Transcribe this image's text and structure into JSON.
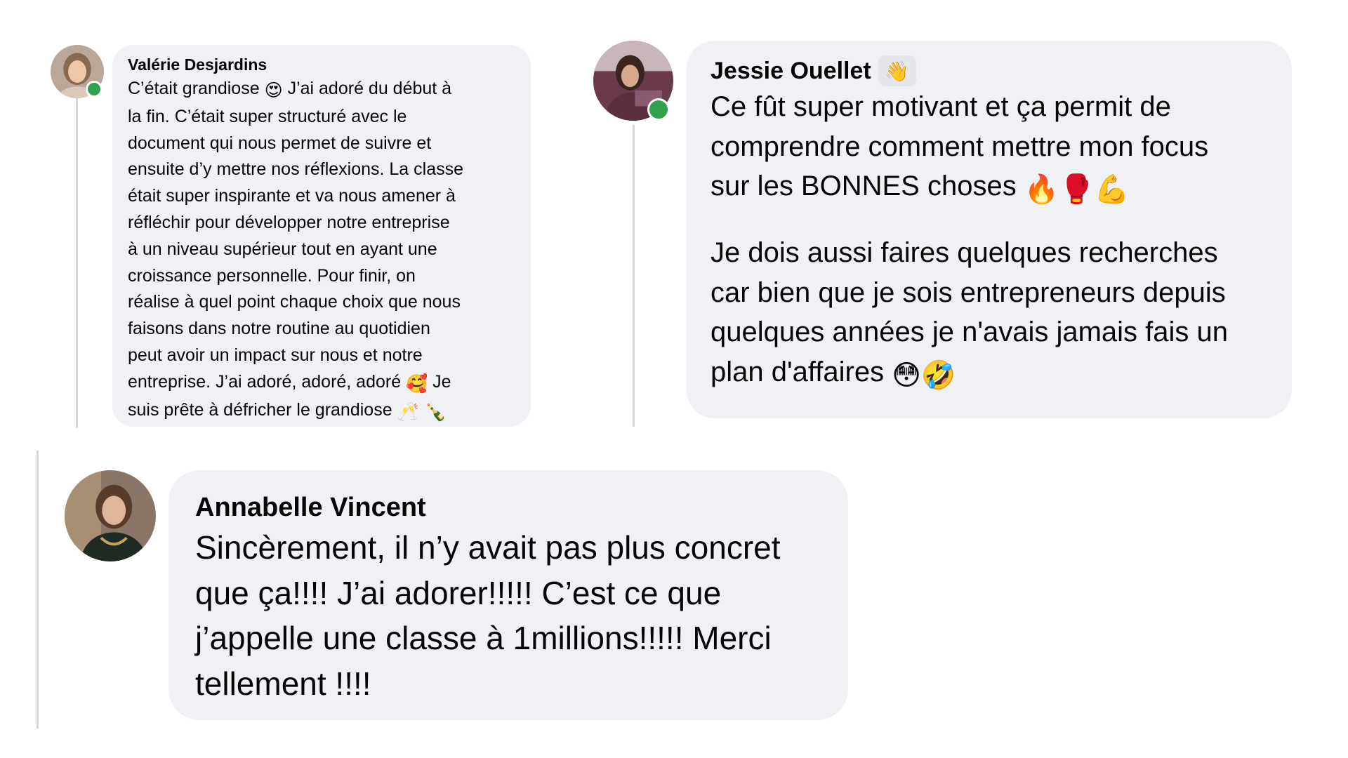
{
  "comments": [
    {
      "author": "Valérie Desjardins",
      "avatar_icon": "avatar-photo",
      "online": true,
      "lines": [
        {
          "before": "C’était grandiose ",
          "emoji": "😍",
          "after": " J’ai adoré du début à"
        },
        {
          "text": "la fin. C’était super structuré avec le"
        },
        {
          "text": "document qui nous permet de suivre et"
        },
        {
          "text": "ensuite d’y mettre nos réflexions. La classe"
        },
        {
          "text": "était super inspirante et va nous amener à"
        },
        {
          "text": "réfléchir pour développer notre entreprise"
        },
        {
          "text": "à un niveau supérieur tout en ayant une"
        },
        {
          "text": "croissance personnelle. Pour finir, on"
        },
        {
          "text": "réalise à quel point chaque choix que nous"
        },
        {
          "text": "faisons dans notre routine au quotidien"
        },
        {
          "text": "peut avoir un impact sur nous et notre"
        },
        {
          "before": "entreprise. J’ai adoré, adoré, adoré ",
          "emoji": "🥰",
          "after": " Je"
        },
        {
          "before": "suis prête à défricher le grandiose ",
          "emoji": "🥂 🍾",
          "after": ""
        }
      ]
    },
    {
      "author": "Jessie Ouellet",
      "author_badge": "👋",
      "avatar_icon": "avatar-photo",
      "online": true,
      "lines": [
        {
          "text": "Ce fût super motivant et ça permit de"
        },
        {
          "text": "comprendre comment mettre mon focus"
        },
        {
          "before": "sur les BONNES choses ",
          "emoji": "🔥🥊💪",
          "after": ""
        },
        {
          "blank": true
        },
        {
          "text": "Je dois aussi faires quelques recherches"
        },
        {
          "text": "car bien que je sois entrepreneurs depuis"
        },
        {
          "text": "quelques années je n'avais jamais fais un"
        },
        {
          "before": "plan d'affaires ",
          "emoji": "😳🤣",
          "after": ""
        }
      ]
    },
    {
      "author": "Annabelle Vincent",
      "avatar_icon": "avatar-photo",
      "online": false,
      "lines": [
        {
          "text": "Sincèrement, il n’y avait pas plus concret"
        },
        {
          "text": "que ça!!!! J’ai adorer!!!!! C’est ce que"
        },
        {
          "text": "j’appelle une classe à 1millions!!!!! Merci"
        },
        {
          "text": "tellement !!!!"
        }
      ]
    }
  ],
  "colors": {
    "bubble": "#eff1f5",
    "online": "#31a24c",
    "thread_line": "#d6d9de",
    "text": "#050505"
  }
}
